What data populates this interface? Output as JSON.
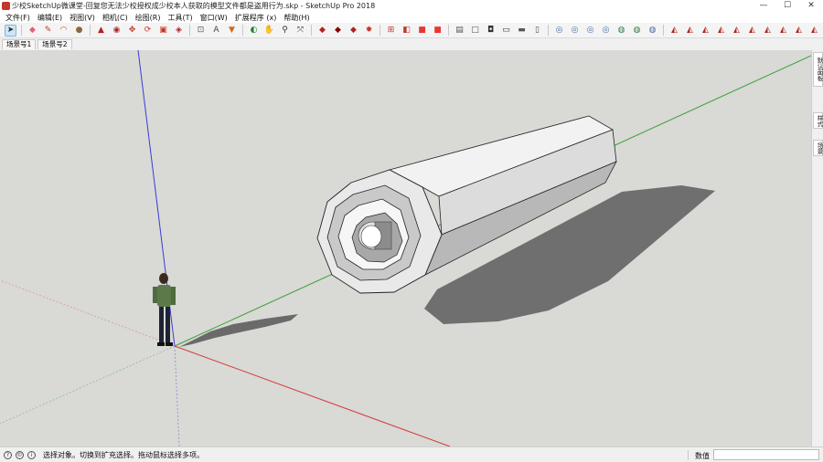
{
  "window": {
    "title": "少校SketchUp微课堂-回复您无法少校授权成少校本人获取的模型文件都是盗用行为.skp - SketchUp Pro 2018",
    "controls": [
      "—",
      "☐",
      "✕"
    ]
  },
  "menu": [
    "文件(F)",
    "编辑(E)",
    "视图(V)",
    "相机(C)",
    "绘图(R)",
    "工具(T)",
    "窗口(W)",
    "扩展程序 (x)",
    "帮助(H)"
  ],
  "toolbar": {
    "icons": [
      {
        "name": "select-icon",
        "color": "#2b2b2b",
        "glyph": "➤"
      },
      {
        "name": "eraser-icon",
        "color": "#e0607e",
        "glyph": "◆"
      },
      {
        "name": "pencil-icon",
        "color": "#c0392b",
        "glyph": "✎"
      },
      {
        "name": "arc-icon",
        "color": "#c0392b",
        "glyph": "◠"
      },
      {
        "name": "shape-icon",
        "color": "#8a6a3a",
        "glyph": "●"
      },
      {
        "name": "push-pull-icon",
        "color": "#b22222",
        "glyph": "▲"
      },
      {
        "name": "follow-me-icon",
        "color": "#b22222",
        "glyph": "◉"
      },
      {
        "name": "move-icon",
        "color": "#c0392b",
        "glyph": "✥"
      },
      {
        "name": "rotate-icon",
        "color": "#c0392b",
        "glyph": "⟳"
      },
      {
        "name": "scale-icon",
        "color": "#c0392b",
        "glyph": "▣"
      },
      {
        "name": "offset-icon",
        "color": "#b22222",
        "glyph": "◈"
      },
      {
        "name": "tape-measure-icon",
        "color": "#555555",
        "glyph": "⊡"
      },
      {
        "name": "text-icon",
        "color": "#444444",
        "glyph": "A"
      },
      {
        "name": "paint-bucket-icon",
        "color": "#d2691e",
        "glyph": "▼"
      },
      {
        "name": "orbit-icon",
        "color": "#2e7d32",
        "glyph": "◐"
      },
      {
        "name": "pan-icon",
        "color": "#555555",
        "glyph": "✋"
      },
      {
        "name": "zoom-icon",
        "color": "#333333",
        "glyph": "⚲"
      },
      {
        "name": "zoom-extents-icon",
        "color": "#333333",
        "glyph": "⤧"
      },
      {
        "name": "warehouse-icon",
        "color": "#b22222",
        "glyph": "◆"
      },
      {
        "name": "extension-warehouse-icon",
        "color": "#8b0000",
        "glyph": "◆"
      },
      {
        "name": "ruby-icon",
        "color": "#b22222",
        "glyph": "◆"
      },
      {
        "name": "sun-icon",
        "color": "#c0392b",
        "glyph": "✹"
      },
      {
        "name": "components-icon",
        "color": "#c0392b",
        "glyph": "⊞"
      },
      {
        "name": "styles-icon",
        "color": "#c0392b",
        "glyph": "◧"
      },
      {
        "name": "layout-icon",
        "color": "#e53935",
        "glyph": "■"
      },
      {
        "name": "style-builder-icon",
        "color": "#e53935",
        "glyph": "■"
      },
      {
        "name": "iso-view-icon",
        "color": "#555555",
        "glyph": "▤"
      },
      {
        "name": "top-view-icon",
        "color": "#555555",
        "glyph": "□"
      },
      {
        "name": "front-view-icon",
        "color": "#333333",
        "glyph": "◘"
      },
      {
        "name": "right-view-icon",
        "color": "#333333",
        "glyph": "▭"
      },
      {
        "name": "back-view-icon",
        "color": "#555555",
        "glyph": "▬"
      },
      {
        "name": "left-view-icon",
        "color": "#555555",
        "glyph": "▯"
      },
      {
        "name": "xray-icon",
        "color": "#4a6fa5",
        "glyph": "◎"
      },
      {
        "name": "back-edges-icon",
        "color": "#4a6fa5",
        "glyph": "◎"
      },
      {
        "name": "wireframe-icon",
        "color": "#4a6fa5",
        "glyph": "◎"
      },
      {
        "name": "hidden-line-icon",
        "color": "#4a6fa5",
        "glyph": "◎"
      },
      {
        "name": "shaded-icon",
        "color": "#3a7d44",
        "glyph": "◍"
      },
      {
        "name": "shaded-textures-icon",
        "color": "#3a7d44",
        "glyph": "◍"
      },
      {
        "name": "monochrome-icon",
        "color": "#4a6fa5",
        "glyph": "◍"
      },
      {
        "name": "section-plane-icon",
        "color": "#b22222",
        "glyph": "◭"
      },
      {
        "name": "display-section-icon",
        "color": "#b22222",
        "glyph": "◭"
      },
      {
        "name": "display-cuts-icon",
        "color": "#b22222",
        "glyph": "◭"
      },
      {
        "name": "section-fill-icon",
        "color": "#b22222",
        "glyph": "◭"
      },
      {
        "name": "sandbox-contours-icon",
        "color": "#b22222",
        "glyph": "◭"
      },
      {
        "name": "sandbox-scratch-icon",
        "color": "#b22222",
        "glyph": "◭"
      },
      {
        "name": "sandbox-smoove-icon",
        "color": "#b22222",
        "glyph": "◭"
      },
      {
        "name": "sandbox-stamp-icon",
        "color": "#b22222",
        "glyph": "◭"
      },
      {
        "name": "sandbox-drape-icon",
        "color": "#b22222",
        "glyph": "◭"
      },
      {
        "name": "sandbox-detail-icon",
        "color": "#b22222",
        "glyph": "◭"
      },
      {
        "name": "sandbox-flip-icon",
        "color": "#b22222",
        "glyph": "◭"
      },
      {
        "name": "instructor-icon",
        "color": "#d4a017",
        "glyph": "●"
      },
      {
        "name": "settings-icon",
        "color": "#333333",
        "glyph": "✱"
      }
    ]
  },
  "scenes": [
    "场景号1",
    "场景号2"
  ],
  "tray": [
    "默认面板",
    "样式",
    "场景"
  ],
  "statusbar": {
    "icons": [
      "?",
      "©",
      "i"
    ],
    "hint": "选择对象。切换到扩充选择。拖动鼠标选择多项。",
    "measure_label": "数值",
    "measure_value": ""
  }
}
